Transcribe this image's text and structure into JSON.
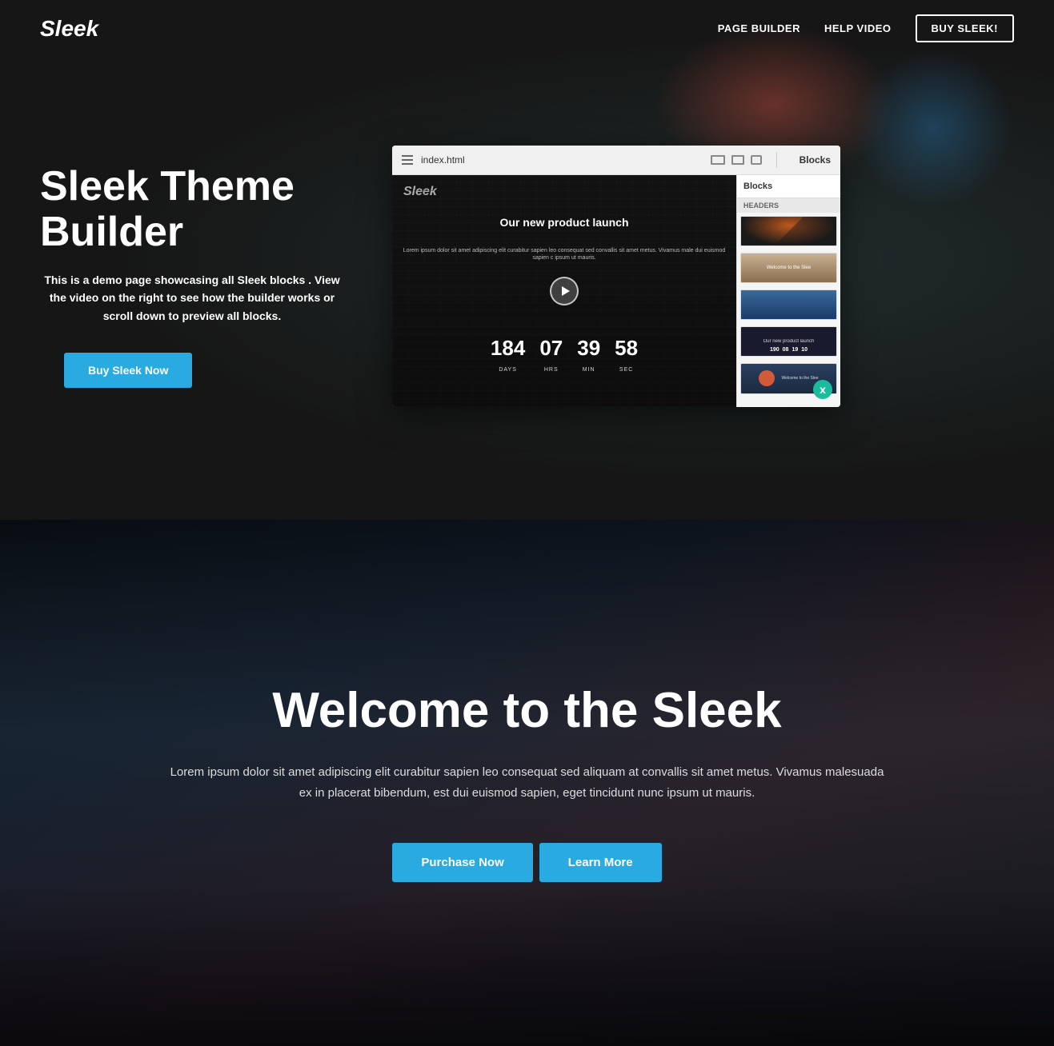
{
  "site": {
    "logo": "Sleek"
  },
  "header": {
    "nav": [
      {
        "label": "PAGE BUILDER",
        "href": "#"
      },
      {
        "label": "HELP VIDEO",
        "href": "#"
      },
      {
        "label": "BUY SLEEK!",
        "href": "#",
        "style": "outlined"
      }
    ]
  },
  "hero": {
    "title": "Sleek Theme Builder",
    "description": "This is a demo page showcasing all Sleek blocks . View the video on the right to see how the builder works or scroll down to preview all blocks.",
    "cta_label": "Buy Sleek Now",
    "preview": {
      "url_bar": "index.html",
      "blocks_label": "Blocks",
      "blocks_section": "HEADERS",
      "inner_logo": "Sleek",
      "headline": "Our new product launch",
      "lorem": "Lorem ipsum dolor sit amet adipiscing elit curabitur sapien leo consequat sed convallis sit amet metus. Vivamus male dui euismod sapien c ipsum ut mauris.",
      "countdown": [
        {
          "num": "184",
          "label": "DAYS"
        },
        {
          "num": "07",
          "label": "HRS"
        },
        {
          "num": "39",
          "label": "MIN"
        },
        {
          "num": "58",
          "label": "SEC"
        }
      ],
      "bottom_row": [
        {
          "num": "190",
          "label": ""
        },
        {
          "num": "08",
          "label": ""
        },
        {
          "num": "19",
          "label": ""
        },
        {
          "num": "10",
          "label": ""
        }
      ],
      "close_btn": "x"
    }
  },
  "welcome": {
    "title": "Welcome to the Sleek",
    "description": "Lorem ipsum dolor sit amet adipiscing elit curabitur sapien leo consequat sed aliquam at convallis sit amet metus. Vivamus malesuada ex in placerat bibendum, est dui euismod sapien, eget tincidunt nunc ipsum ut mauris.",
    "btn_purchase": "Purchase Now",
    "btn_learn": "Learn More"
  }
}
